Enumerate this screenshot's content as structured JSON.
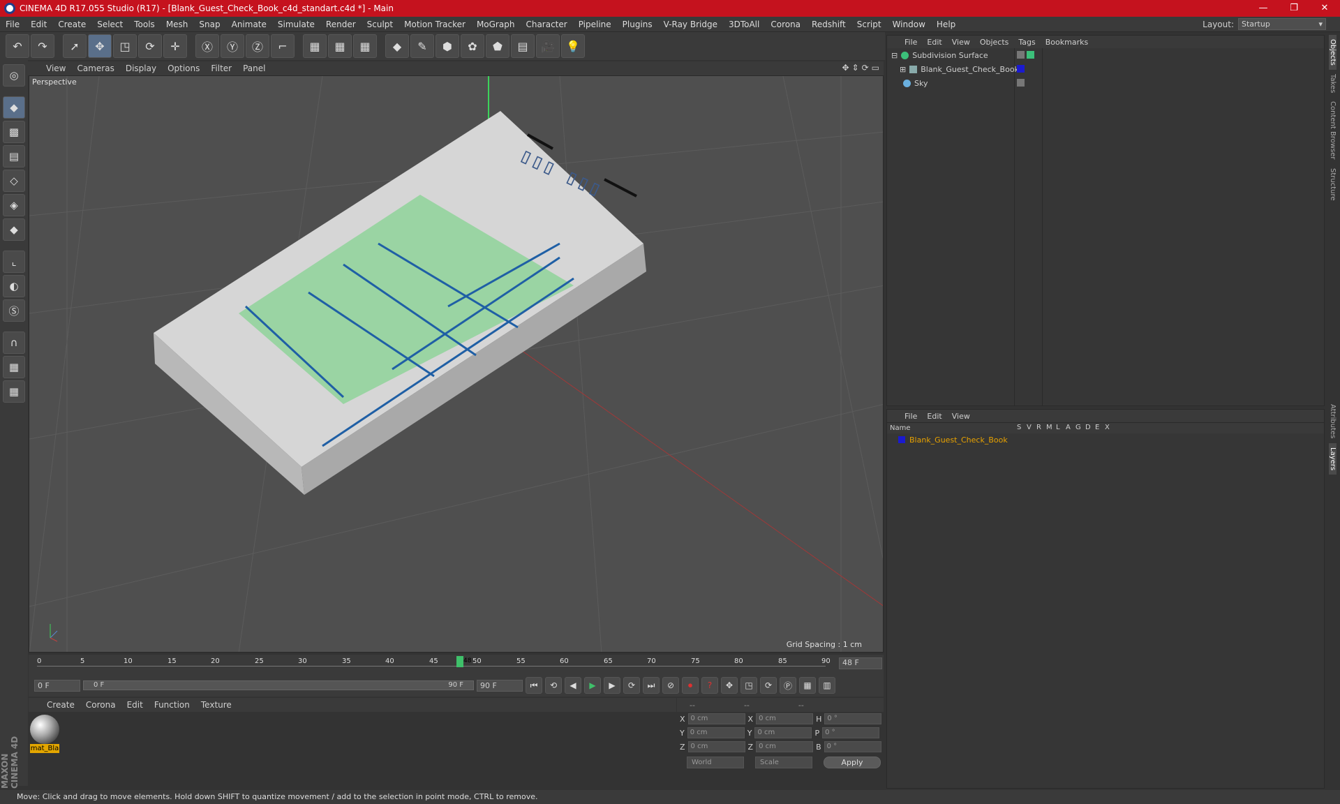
{
  "window": {
    "title": "CINEMA 4D R17.055 Studio (R17) - [Blank_Guest_Check_Book_c4d_standart.c4d *] - Main",
    "controls": [
      "—",
      "❐",
      "✕"
    ]
  },
  "menu": [
    "File",
    "Edit",
    "Create",
    "Select",
    "Tools",
    "Mesh",
    "Snap",
    "Animate",
    "Simulate",
    "Render",
    "Sculpt",
    "Motion Tracker",
    "MoGraph",
    "Character",
    "Pipeline",
    "Plugins",
    "V-Ray Bridge",
    "3DToAll",
    "Corona",
    "Redshift",
    "Script",
    "Window",
    "Help"
  ],
  "layout": {
    "label": "Layout:",
    "value": "Startup"
  },
  "viewport": {
    "menu": [
      "View",
      "Cameras",
      "Display",
      "Options",
      "Filter",
      "Panel"
    ],
    "camera": "Perspective",
    "grid_spacing": "Grid Spacing : 1 cm"
  },
  "timeline": {
    "ticks": [
      "0",
      "5",
      "10",
      "15",
      "20",
      "25",
      "30",
      "35",
      "40",
      "45",
      "50",
      "55",
      "60",
      "65",
      "70",
      "75",
      "80",
      "85",
      "90"
    ],
    "current": "48",
    "end": "48 F"
  },
  "transport": {
    "start": "0 F",
    "slider_start": "0 F",
    "slider_end": "90 F",
    "end": "90 F"
  },
  "material": {
    "menu": [
      "Create",
      "Corona",
      "Edit",
      "Function",
      "Texture"
    ],
    "name": "mat_Bla"
  },
  "coords": {
    "headers": [
      "--",
      "--",
      "--"
    ],
    "rows": [
      {
        "a": "X",
        "av": "0 cm",
        "b": "X",
        "bv": "0 cm",
        "c": "H",
        "cv": "0 °"
      },
      {
        "a": "Y",
        "av": "0 cm",
        "b": "Y",
        "bv": "0 cm",
        "c": "P",
        "cv": "0 °"
      },
      {
        "a": "Z",
        "av": "0 cm",
        "b": "Z",
        "bv": "0 cm",
        "c": "B",
        "cv": "0 °"
      }
    ],
    "space": "World",
    "mode": "Scale",
    "apply": "Apply"
  },
  "objects": {
    "menu": [
      "File",
      "Edit",
      "View",
      "Objects",
      "Tags",
      "Bookmarks"
    ],
    "items": [
      {
        "name": "Subdivision Surface"
      },
      {
        "name": "Blank_Guest_Check_Book"
      },
      {
        "name": "Sky"
      }
    ]
  },
  "layers": {
    "menu": [
      "File",
      "Edit",
      "View"
    ],
    "name_col": "Name",
    "cols": [
      "S",
      "V",
      "R",
      "M",
      "L",
      "A",
      "G",
      "D",
      "E",
      "X"
    ],
    "item": "Blank_Guest_Check_Book"
  },
  "sidetabs": [
    "Objects",
    "Takes",
    "Content Browser",
    "Structure",
    "Attributes",
    "Layers"
  ],
  "status": "Move: Click and drag to move elements. Hold down SHIFT to quantize movement / add to the selection in point mode, CTRL to remove.",
  "brand": "MAXON CINEMA 4D",
  "colors": {
    "title": "#c5121e",
    "layer": "#1a1ad0",
    "material_tag": "#e3a600"
  }
}
